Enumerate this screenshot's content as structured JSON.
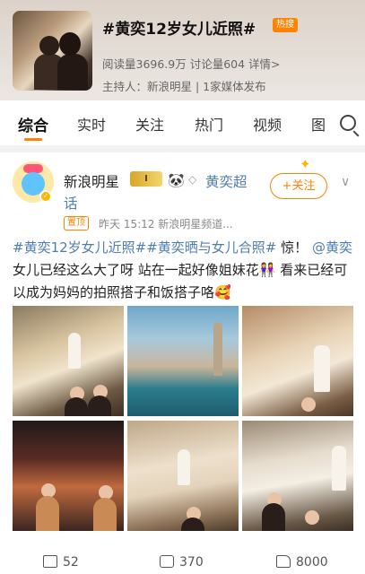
{
  "topic": {
    "title": "#黄奕12岁女儿近照#",
    "hot_badge": "热搜",
    "stats": "阅读量3696.9万  讨论量604  详情>",
    "host": "主持人：新浪明星 | 1家媒体发布"
  },
  "tabs": [
    {
      "label": "综合",
      "active": true
    },
    {
      "label": "实时"
    },
    {
      "label": "关注"
    },
    {
      "label": "热门"
    },
    {
      "label": "视频"
    },
    {
      "label": "图"
    }
  ],
  "post": {
    "author": "新浪明星",
    "crown_badge": "I",
    "super_topic_line1": "黄奕超",
    "super_topic_line2": "话",
    "follow_label": "+关注",
    "pin_tag": "置顶",
    "meta": "昨天 15:12   新浪明星频道...",
    "text_link1": "#黄奕12岁女儿近照#",
    "text_link2": "#黄奕晒与女儿合照#",
    "text_plain1": " 惊！",
    "text_mention": "@黄奕",
    "text_plain2": " 女儿已经这么大了呀 站在一起好像姐妹花👭 看来已经可以成为妈妈的拍照搭子和饭搭子咯🥰"
  },
  "actions": {
    "share_count": "52",
    "comment_count": "370",
    "like_count": "8000"
  },
  "colors": {
    "accent": "#ff8200",
    "link": "#507daf"
  }
}
